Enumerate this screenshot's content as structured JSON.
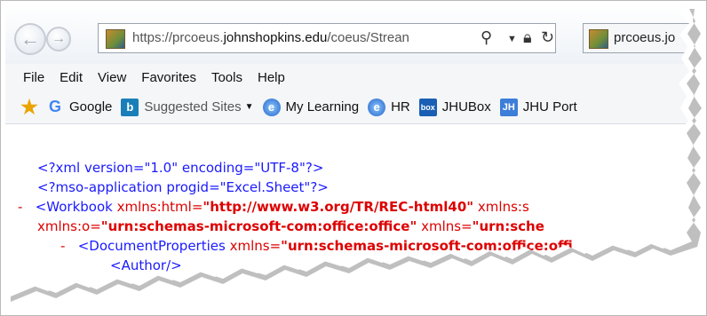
{
  "browser": {
    "url_prefix": "https://prcoeus.",
    "url_domain": "johnshopkins.edu",
    "url_suffix": "/coeus/Strean",
    "tab_title": "prcoeus.jo",
    "icons": {
      "back": "back-arrow-icon",
      "forward": "forward-arrow-icon",
      "search": "search-icon",
      "dropdown": "chevron-down-icon",
      "lock": "lock-icon",
      "refresh": "refresh-icon",
      "site": "site-favicon"
    }
  },
  "menu": [
    "File",
    "Edit",
    "View",
    "Favorites",
    "Tools",
    "Help"
  ],
  "favorites": [
    {
      "label": "Google",
      "icon": "google-icon"
    },
    {
      "label": "Suggested Sites",
      "icon": "bing-icon",
      "dropdown": true
    },
    {
      "label": "My Learning",
      "icon": "ie-icon"
    },
    {
      "label": "HR",
      "icon": "ie-icon"
    },
    {
      "label": "JHUBox",
      "icon": "box-icon"
    },
    {
      "label": "JHU Port",
      "icon": "jh-icon"
    }
  ],
  "xml": {
    "line1": "<?xml version=\"1.0\" encoding=\"UTF-8\"?>",
    "line2": "<?mso-application progid=\"Excel.Sheet\"?>",
    "line3_dash": "-",
    "line3_tag": "<Workbook",
    "line3_attr": "xmlns:html=",
    "line3_value": "\"http://www.w3.org/TR/REC-html40\"",
    "line3_attr2": "xmlns:s",
    "line4_attr": "xmlns:o=",
    "line4_value": "\"urn:schemas-microsoft-com:office:office\"",
    "line4_attr2": "xmlns=",
    "line4_value2": "\"urn:sche",
    "line5_dash": "-",
    "line5_tag": "<DocumentProperties",
    "line5_attr": "xmlns=",
    "line5_value": "\"urn:schemas-microsoft-com:office:offi",
    "line6": "<Author/>"
  },
  "colors": {
    "xml_blue": "#1a1aff",
    "xml_red": "#dd0000"
  }
}
